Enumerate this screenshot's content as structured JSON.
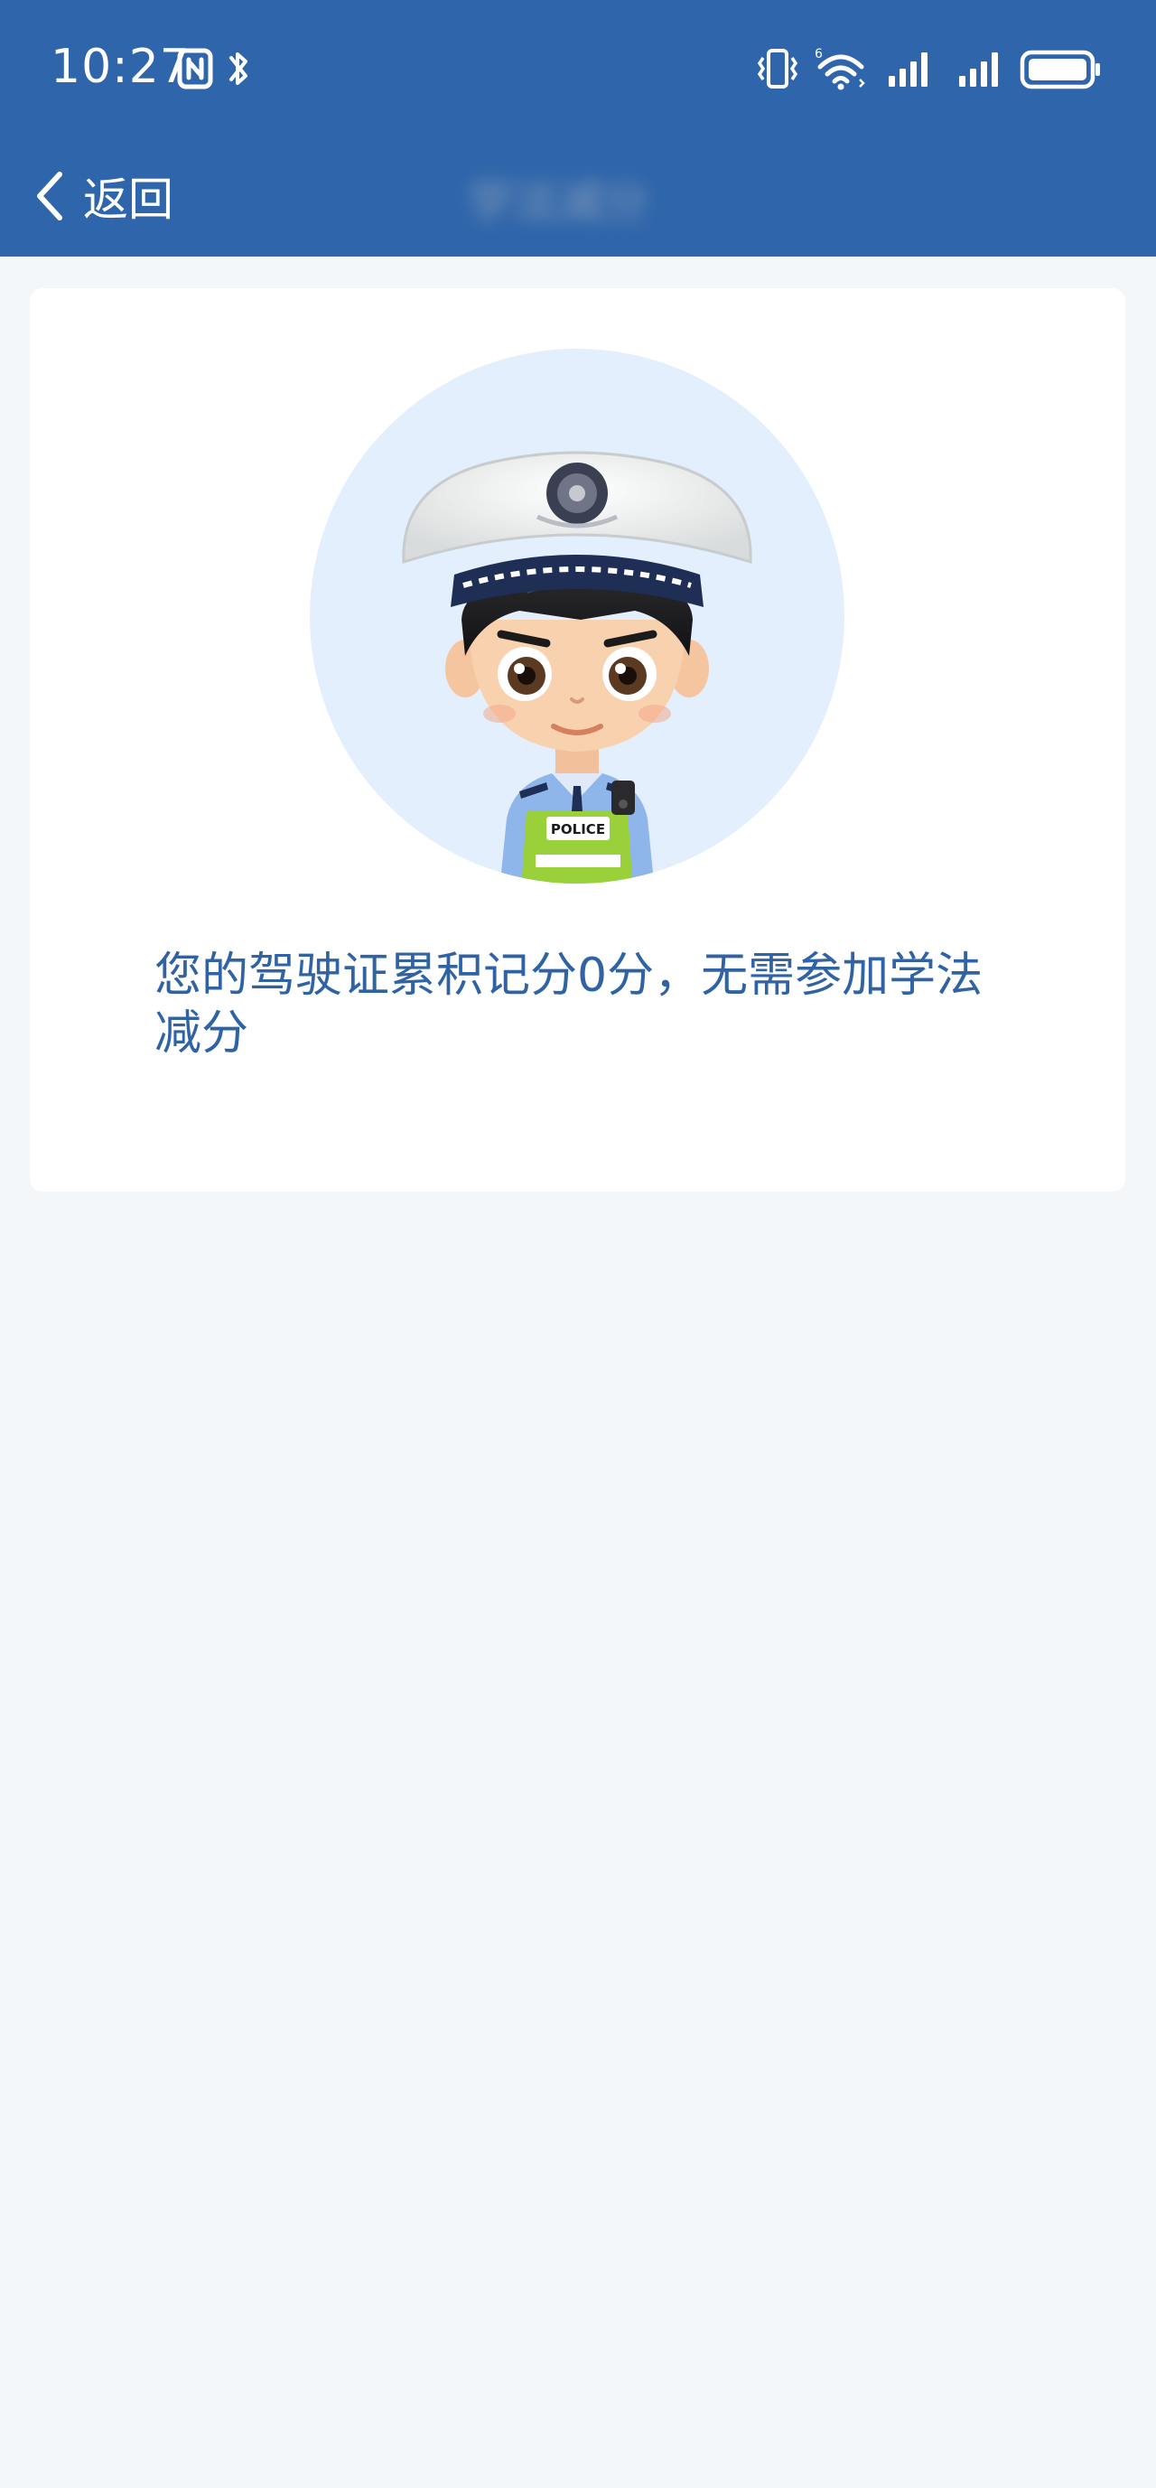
{
  "status_bar": {
    "time": "10:27",
    "icons": [
      "nfc-icon",
      "bluetooth-icon",
      "vibrate-icon",
      "wifi-icon",
      "signal-icon",
      "signal-icon",
      "battery-icon"
    ]
  },
  "nav": {
    "back_label": "返回",
    "title": "学法减分"
  },
  "card": {
    "message": "您的驾驶证累积记分0分，无需参加学法减分",
    "avatar_badge": "POLICE"
  },
  "colors": {
    "header": "#2f65aa",
    "page_background": "#f3f7f9",
    "card_background": "#ffffff",
    "message_text": "#2f63a4",
    "avatar_circle": "#e3effd"
  }
}
